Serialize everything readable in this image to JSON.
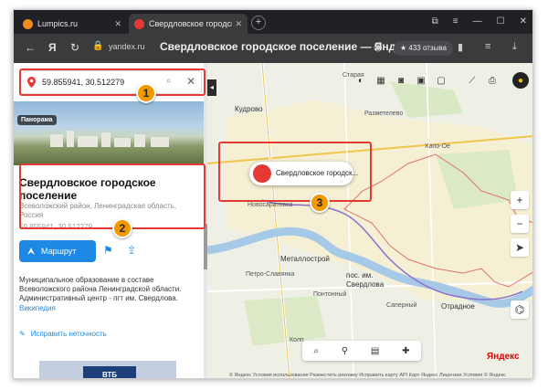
{
  "browser": {
    "tabs": [
      {
        "label": "Lumpics.ru",
        "active": false
      },
      {
        "label": "Свердловское городск",
        "active": true
      }
    ],
    "url": "yandex.ru",
    "page_title": "Свердловское городское поселение — Яндек...",
    "reviews_label": "★ 433 отзыва"
  },
  "search": {
    "value": "59.855941, 30.512279"
  },
  "panel": {
    "panorama_label": "Панорама",
    "title": "Свердловское городское поселение",
    "subtitle": "Всеволожский район, Ленинградская область, Россия",
    "coords": "59.855941, 30.512279",
    "route_button": "Маршрут",
    "description": "Муниципальное образование в составе Всеволожского района Ленинградской области. Административный центр - пгт им. Свердлова.",
    "wiki_link": "Википедия",
    "fix_link": "Исправить неточность",
    "ad_text": "ВТБ"
  },
  "map": {
    "labels": {
      "staraya": "Старая",
      "kudrovo": "Кудрово",
      "razmetelevo": "Разметелево",
      "hapo_oe": "Хапо-Ое",
      "novosaratovka": "Новосаратовка",
      "metallostroy": "Металлострой",
      "petro_slavyanka": "Петро-Славянка",
      "pos_sverdlova_1": "пос. им.",
      "pos_sverdlova_2": "Свердлова",
      "pontonny": "Понтонный",
      "saperny": "Саперный",
      "otradnoe": "Отрадное",
      "koll": "Колп"
    },
    "popup_label": "Свердловское городск...",
    "logo": "Яндекс",
    "copyright": "© Яндекс  Условия использования  Разместить рекламу  Исправить карту  API Карт  Яндекс  Лицензии  Условия  © Яндекс",
    "scale": "3 км"
  },
  "annotations": [
    "1",
    "2",
    "3"
  ],
  "colors": {
    "accent_blue": "#1e88e5",
    "highlight_red": "#e53935",
    "badge_orange": "#f29900",
    "browser_dark": "#202124"
  }
}
